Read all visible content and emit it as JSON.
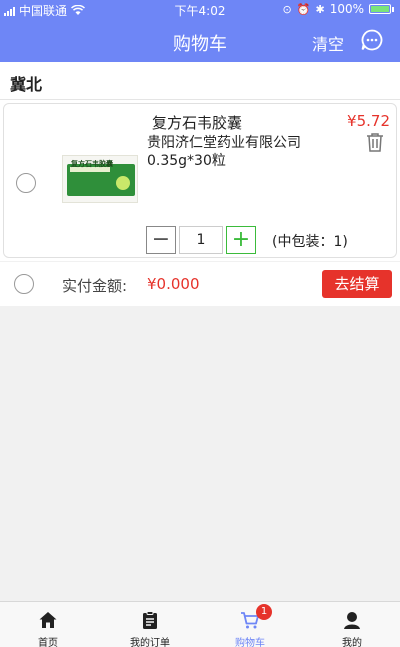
{
  "status_bar": {
    "carrier": "中国联通",
    "time": "下午4:02",
    "battery": "100%"
  },
  "nav": {
    "title": "购物车",
    "clear_label": "清空",
    "chat_icon": "chat-bubble-icon"
  },
  "region": "冀北",
  "cart_item": {
    "image_text": "复方石韦胶囊",
    "name": "复方石韦胶囊",
    "price": "¥5.72",
    "manufacturer": "贵阳济仁堂药业有限公司",
    "spec": "0.35g*30粒",
    "quantity": "1",
    "pack_info": "(中包装：1)",
    "minus_label": "−",
    "plus_label": "+"
  },
  "summary": {
    "label": "实付金额:",
    "amount": "¥0.000",
    "checkout_label": "去结算"
  },
  "tabs": [
    {
      "label": "首页",
      "icon": "home-icon"
    },
    {
      "label": "我的订单",
      "icon": "orders-icon"
    },
    {
      "label": "购物车",
      "icon": "cart-icon",
      "badge": "1",
      "active": true
    },
    {
      "label": "我的",
      "icon": "profile-icon"
    }
  ],
  "colors": {
    "brand": "#6e86f6",
    "price": "#e6332b",
    "plus": "#3bbb3b"
  }
}
